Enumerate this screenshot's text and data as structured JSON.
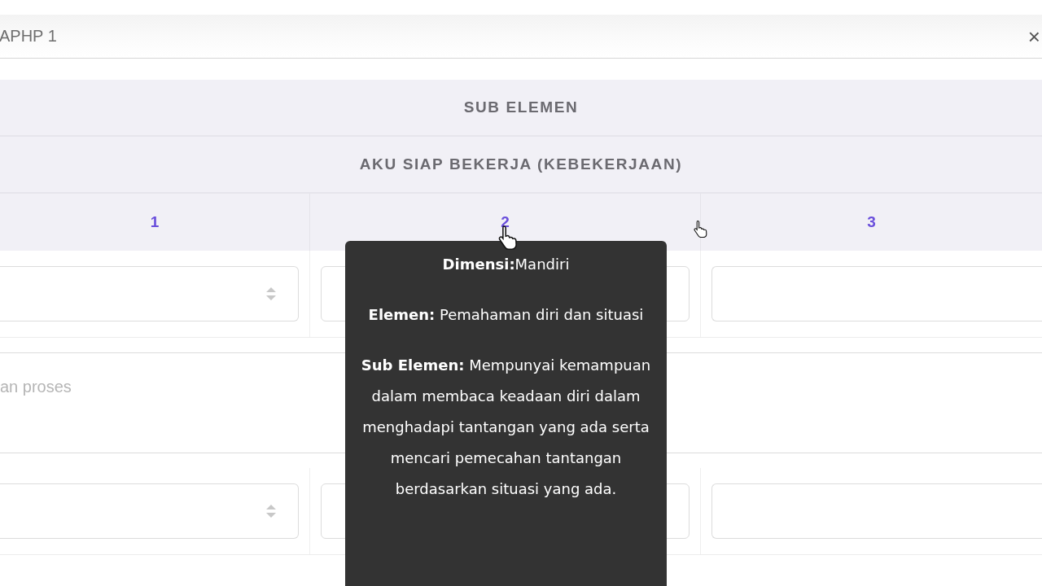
{
  "dialog": {
    "title": "APHP 1",
    "close_label": "×"
  },
  "table": {
    "header": "SUB ELEMEN",
    "group": "AKU SIAP BEKERJA (KEBEKERJAAN)",
    "columns": [
      "1",
      "2",
      "3"
    ],
    "rows": [
      {
        "kind": "inputs",
        "cells": [
          {
            "kind": "select"
          },
          {
            "kind": "input"
          },
          {
            "kind": "input"
          }
        ]
      },
      {
        "kind": "note",
        "placeholder": "an proses"
      },
      {
        "kind": "inputs",
        "cells": [
          {
            "kind": "select"
          },
          {
            "kind": "input"
          },
          {
            "kind": "input"
          }
        ]
      }
    ]
  },
  "tooltip": {
    "paragraphs": [
      "**Dimensi:**Mandiri",
      "**Elemen:** Pemahaman diri dan situasi",
      "**Sub Elemen:** Mempunyai kemampuan dalam membaca keadaan diri dalam menghadapi tantangan yang ada serta mencari pemecahan tantangan berdasarkan situasi yang ada."
    ]
  }
}
